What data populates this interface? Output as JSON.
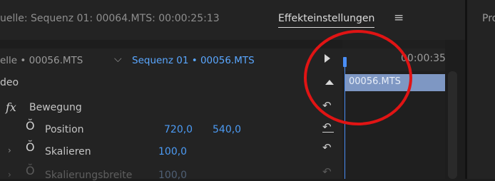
{
  "header": {
    "source_tab": "uelle: Sequenz 01: 00064.MTS: 00:00:25:13",
    "effect_tab": "Effekteinstellungen",
    "menu_icon": "≡",
    "right_panel_label": "Pro"
  },
  "clip_selector": {
    "master_clip": "elle • 00056.MTS",
    "chevron": "⌵",
    "sequence_clip": "Sequenz 01 • 00056.MTS"
  },
  "timeline": {
    "timecode": "00:00:35",
    "clip_label": "00056.MTS"
  },
  "properties": {
    "video_label": "deo",
    "fx_badge": "fx",
    "motion_label": "Bewegung",
    "stopwatch_glyph": "Ŏ",
    "reset_glyph": "↶",
    "chevron_glyph": "›",
    "position": {
      "label": "Position",
      "x": "720,0",
      "y": "540,0"
    },
    "scale": {
      "label": "Skalieren",
      "value": "100,0"
    },
    "scale_width": {
      "label": "Skalierungsbreite",
      "value": "100,0"
    }
  },
  "colors": {
    "accent_blue": "#4c9bf4",
    "clip_block": "#7e97c3",
    "annotation_red": "#e01414"
  }
}
